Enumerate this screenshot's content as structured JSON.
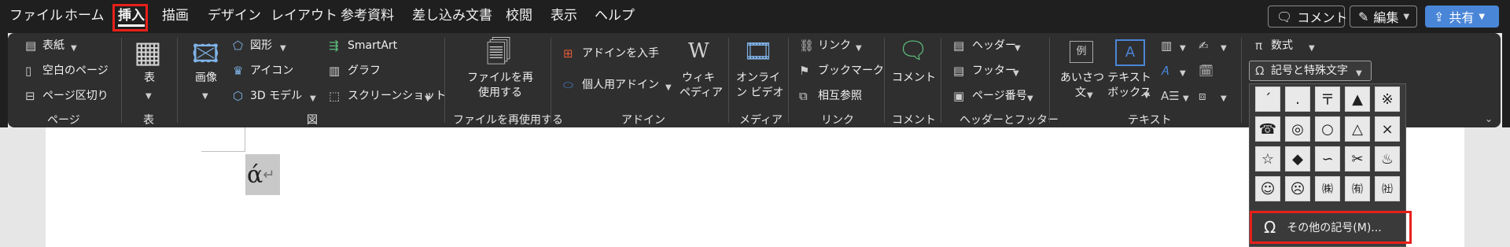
{
  "menu": {
    "tabs": [
      "ファイル",
      "ホーム",
      "挿入",
      "描画",
      "デザイン",
      "レイアウト",
      "参考資料",
      "差し込み文書",
      "校閲",
      "表示",
      "ヘルプ"
    ],
    "active_tab": "挿入",
    "comment_button": "コメント",
    "edit_button": "編集",
    "share_button": "共有"
  },
  "ribbon": {
    "page": {
      "cover": "表紙",
      "blank": "空白のページ",
      "break": "ページ区切り",
      "label": "ページ"
    },
    "table": {
      "button": "表",
      "label": "表"
    },
    "illustrations": {
      "picture": "画像",
      "shapes": "図形",
      "icons": "アイコン",
      "model3d": "3D モデル",
      "smartart": "SmartArt",
      "chart": "グラフ",
      "screenshot": "スクリーンショット",
      "label": "図"
    },
    "reuse": {
      "button_line1": "ファイルを再",
      "button_line2": "使用する",
      "label": "ファイルを再使用する"
    },
    "addins": {
      "get": "アドインを入手",
      "personal": "個人用アドイン",
      "wiki_line1": "ウィキ",
      "wiki_line2": "ペディア",
      "label": "アドイン"
    },
    "media": {
      "video_line1": "オンライ",
      "video_line2": "ン ビデオ",
      "label": "メディア"
    },
    "links": {
      "link": "リンク",
      "bookmark": "ブックマーク",
      "crossref": "相互参照",
      "label": "リンク"
    },
    "comments": {
      "comment": "コメント",
      "label": "コメント"
    },
    "headerfooter": {
      "header": "ヘッダー",
      "footer": "フッター",
      "pagenum": "ページ番号",
      "label": "ヘッダーとフッター"
    },
    "text": {
      "greeting_line1": "あいさつ",
      "greeting_line2": "文",
      "textbox_line1": "テキスト",
      "textbox_line2": "ボックス",
      "label": "テキスト"
    },
    "symbols": {
      "equation": "数式",
      "symbol": "記号と特殊文字"
    }
  },
  "symbol_grid": [
    [
      "´",
      ".",
      "〒",
      "▲",
      "※"
    ],
    [
      "☎",
      "◎",
      "○",
      "△",
      "×"
    ],
    [
      "☆",
      "◆",
      "∽",
      "✂",
      "♨"
    ],
    [
      "☺",
      "☹",
      "㈱",
      "㈲",
      "㈳"
    ]
  ],
  "more_symbols": "その他の記号(M)...",
  "doc": {
    "char": "ά",
    "mark": "↵"
  },
  "colors": {
    "accent_red": "#e8201a",
    "share_blue": "#4a86d8",
    "ribbon_bg": "#2f2f2f",
    "menubar_bg": "#1f1f1f"
  }
}
